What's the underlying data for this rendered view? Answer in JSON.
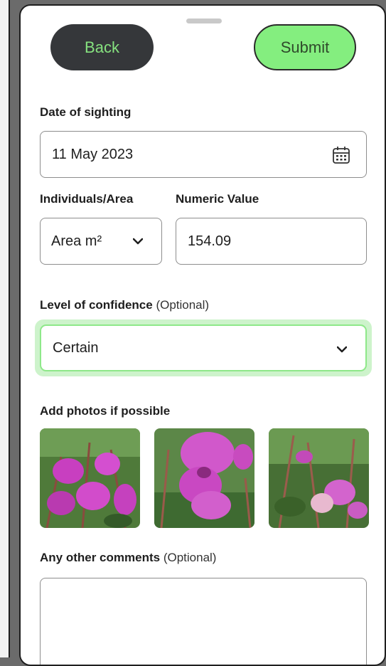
{
  "header": {
    "back_label": "Back",
    "submit_label": "Submit"
  },
  "date": {
    "label": "Date of sighting",
    "value": "11 May 2023",
    "icon": "calendar-icon"
  },
  "quantity": {
    "unit_label": "Individuals/Area",
    "unit_value": "Area m²",
    "numeric_label": "Numeric Value",
    "numeric_value": "154.09"
  },
  "confidence": {
    "label": "Level of confidence",
    "optional": "(Optional)",
    "value": "Certain"
  },
  "photos": {
    "label": "Add photos if possible",
    "items": [
      "photo-1",
      "photo-2",
      "photo-3"
    ]
  },
  "comments": {
    "label": "Any other comments",
    "optional": "(Optional)",
    "value": ""
  },
  "colors": {
    "accent_green": "#84ee7f",
    "dark_button": "#35373a",
    "focus_ring": "#cdf3cb"
  }
}
